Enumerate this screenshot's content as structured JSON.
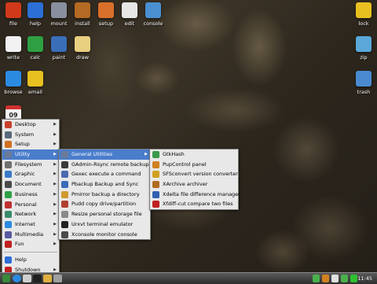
{
  "desktop": {
    "icons": [
      {
        "label": "file",
        "icon": "home-icon",
        "color": "#d03a1a"
      },
      {
        "label": "help",
        "icon": "help-icon",
        "color": "#2c6fd6"
      },
      {
        "label": "mount",
        "icon": "drive-icon",
        "color": "#8a8fa0"
      },
      {
        "label": "install",
        "icon": "box-icon",
        "color": "#b56a24"
      },
      {
        "label": "setup",
        "icon": "setup-icon",
        "color": "#d8702a"
      },
      {
        "label": "edit",
        "icon": "edit-icon",
        "color": "#e6e6e6"
      },
      {
        "label": "console",
        "icon": "monitor-icon",
        "color": "#4a90d0"
      },
      {
        "label": "lock",
        "icon": "lock-icon",
        "color": "#e8c020"
      },
      {
        "label": "write",
        "icon": "document-icon",
        "color": "#f2f2f2"
      },
      {
        "label": "calc",
        "icon": "spreadsheet-icon",
        "color": "#2ea043"
      },
      {
        "label": "paint",
        "icon": "paint-icon",
        "color": "#3a6fb8"
      },
      {
        "label": "draw",
        "icon": "draw-icon",
        "color": "#e8d080"
      },
      {
        "label": "zip",
        "icon": "zip-icon",
        "color": "#5aa8d8"
      },
      {
        "label": "browse",
        "icon": "globe-icon",
        "color": "#2b8be0"
      },
      {
        "label": "email",
        "icon": "email-icon",
        "color": "#e8c020"
      },
      {
        "label": "trash",
        "icon": "trash-icon",
        "color": "#4a8ad0"
      },
      {
        "label": "09",
        "icon": "calendar-icon",
        "color": "#d03030"
      }
    ]
  },
  "start_menu": {
    "items": [
      {
        "label": "Desktop",
        "icon": "desktop-icon",
        "color": "#c8402a",
        "submenu": true
      },
      {
        "label": "System",
        "icon": "system-icon",
        "color": "#5a6a7a",
        "submenu": true
      },
      {
        "label": "Setup",
        "icon": "setup-icon",
        "color": "#d07020",
        "submenu": true
      },
      {
        "label": "Utility",
        "icon": "utility-icon",
        "color": "#6a7a9a",
        "submenu": true,
        "selected": true
      },
      {
        "label": "Filesystem",
        "icon": "folder-icon",
        "color": "#707070",
        "submenu": true
      },
      {
        "label": "Graphic",
        "icon": "graphic-icon",
        "color": "#3a7ac8",
        "submenu": true
      },
      {
        "label": "Document",
        "icon": "document-icon",
        "color": "#4a4a4a",
        "submenu": true
      },
      {
        "label": "Business",
        "icon": "business-icon",
        "color": "#2ea043",
        "submenu": true
      },
      {
        "label": "Personal",
        "icon": "personal-icon",
        "color": "#c03030",
        "submenu": true
      },
      {
        "label": "Network",
        "icon": "network-icon",
        "color": "#3a8a6a",
        "submenu": true
      },
      {
        "label": "Internet",
        "icon": "internet-icon",
        "color": "#2b8be0",
        "submenu": true
      },
      {
        "label": "Multimedia",
        "icon": "multimedia-icon",
        "color": "#5a5aa0",
        "submenu": true
      },
      {
        "label": "Fun",
        "icon": "fun-icon",
        "color": "#c02020",
        "submenu": true
      }
    ],
    "bottom_items": [
      {
        "label": "Help",
        "icon": "help-icon",
        "color": "#2c6fd6"
      },
      {
        "label": "Shutdown",
        "icon": "shutdown-icon",
        "color": "#c02020",
        "submenu": true
      }
    ]
  },
  "utility_menu": {
    "items": [
      {
        "label": "General Utilities",
        "icon": "utility-icon",
        "color": "#6a7a9a",
        "submenu": true,
        "selected": true
      },
      {
        "label": "GAdmin-Rsync remote backup",
        "icon": "sync-icon",
        "color": "#3a3a3a"
      },
      {
        "label": "Gexec execute a command",
        "icon": "gear-icon",
        "color": "#4a6ab0"
      },
      {
        "label": "Pbackup Backup and Sync",
        "icon": "backup-icon",
        "color": "#3a6ab8"
      },
      {
        "label": "Pmirror backup a directory",
        "icon": "mirror-icon",
        "color": "#d09a30"
      },
      {
        "label": "Pudd copy drive/partition",
        "icon": "drive-icon",
        "color": "#b04030"
      },
      {
        "label": "Resize personal storage file",
        "icon": "resize-icon",
        "color": "#8a8a8a"
      },
      {
        "label": "Urxvt terminal emulator",
        "icon": "terminal-icon",
        "color": "#202020"
      },
      {
        "label": "Xconsole monitor console",
        "icon": "console-icon",
        "color": "#4a4a4a"
      }
    ]
  },
  "general_utilities_menu": {
    "items": [
      {
        "label": "GtkHash",
        "icon": "hash-icon",
        "color": "#3a9a4a"
      },
      {
        "label": "PupControl panel",
        "icon": "panel-icon",
        "color": "#d08020"
      },
      {
        "label": "SFSconvert version converter",
        "icon": "convert-icon",
        "color": "#d0a020"
      },
      {
        "label": "XArchive archiver",
        "icon": "archive-icon",
        "color": "#b06a20"
      },
      {
        "label": "Xdelta file difference manager",
        "icon": "diff-icon",
        "color": "#3060b0"
      },
      {
        "label": "Xfdiff-cut compare two files",
        "icon": "compare-icon",
        "color": "#c02020"
      }
    ]
  },
  "taskbar": {
    "clock": "11:45",
    "items": [
      {
        "icon": "menu-icon",
        "color": "#3a8a3a"
      },
      {
        "icon": "globe-icon",
        "color": "#2b8be0"
      },
      {
        "icon": "window-icon",
        "color": "#d0d0d0"
      },
      {
        "icon": "terminal-icon",
        "color": "#202020"
      },
      {
        "icon": "folder-icon",
        "color": "#e0b040"
      },
      {
        "icon": "desktop-icon",
        "color": "#a0a0a0"
      }
    ],
    "tray": [
      {
        "icon": "update-icon",
        "color": "#4ab04a"
      },
      {
        "icon": "network-icon",
        "color": "#d08020"
      },
      {
        "icon": "volume-icon",
        "color": "#e0e0e0"
      },
      {
        "icon": "battery-icon",
        "color": "#4ab04a"
      },
      {
        "icon": "cpu-icon",
        "color": "#30c030"
      }
    ]
  }
}
